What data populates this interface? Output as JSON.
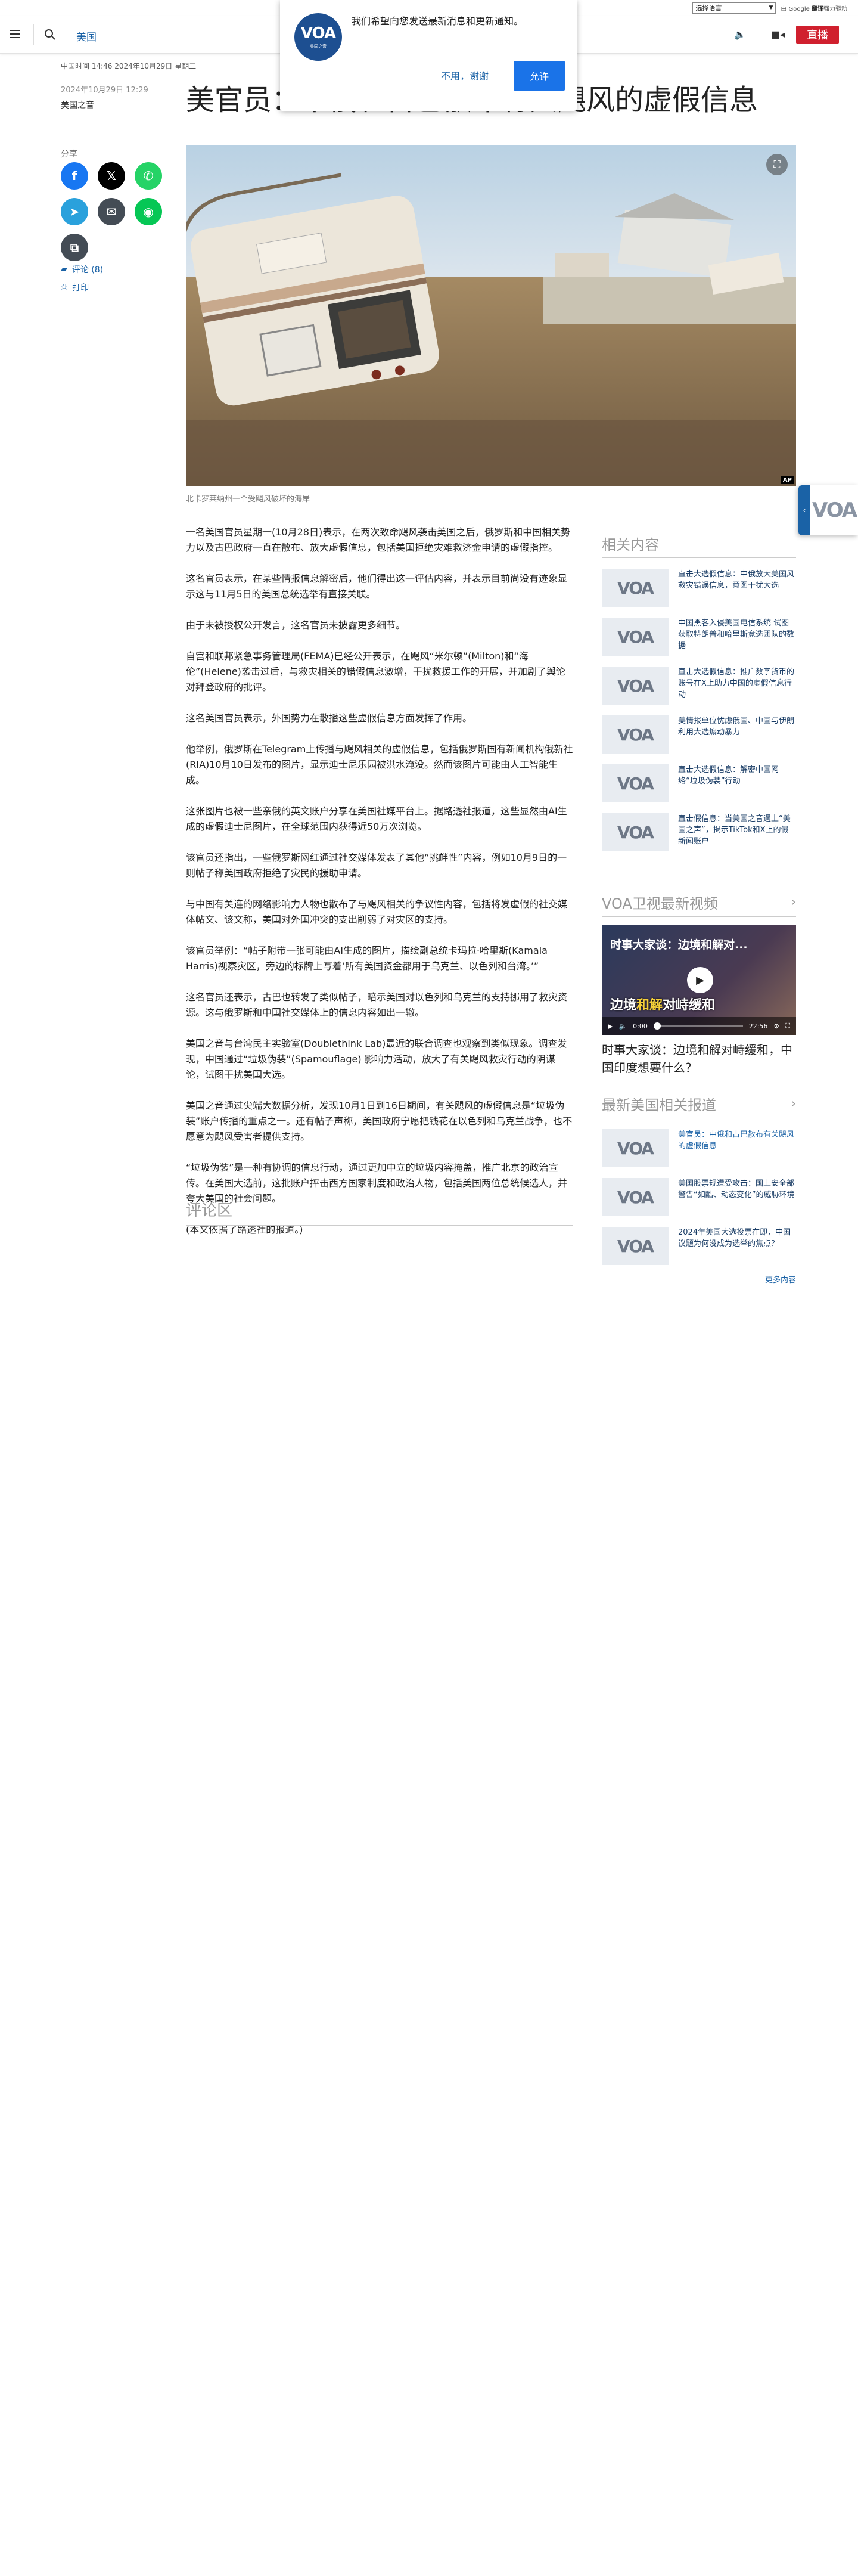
{
  "translate": {
    "select_label": "选择语言",
    "gt_prefix": "由 Google",
    "gt_brand": "翻译",
    "gt_suffix": "强力驱动"
  },
  "header": {
    "section": "美国",
    "live_label": "直播"
  },
  "notification": {
    "logo_text": "VOA",
    "logo_sub": "美国之音",
    "message": "我们希望向您发送最新消息和更新通知。",
    "decline_label": "不用，谢谢",
    "allow_label": "允许"
  },
  "meta": {
    "time": "中国时间 14:46 2024年10月29日 星期二",
    "date": "2024年10月29日 12:29",
    "category": "美国之音"
  },
  "article": {
    "headline": "美官员：中俄和古巴散布有关飓风的虚假信息",
    "caption": "北卡罗莱纳州一个受飓风破坏的海岸",
    "ap_badge": "AP",
    "paragraphs": [
      "一名美国官员星期一(10月28日)表示，在两次致命飓风袭击美国之后，俄罗斯和中国相关势力以及古巴政府一直在散布、放大虚假信息，包括美国拒绝灾难救济金申请的虚假指控。",
      "这名官员表示，在某些情报信息解密后，他们得出这一评估内容，并表示目前尚没有迹象显示这与11月5日的美国总统选举有直接关联。",
      "由于未被授权公开发言，这名官员未披露更多细节。",
      "自宫和联邦紧急事务管理局(FEMA)已经公开表示，在飓风“米尔顿”(Milton)和“海伦”(Helene)袭击过后，与救灾相关的错假信息激增，干扰救援工作的开展，并加剧了舆论对拜登政府的批评。",
      "这名美国官员表示，外国势力在散播这些虚假信息方面发挥了作用。",
      "他举例，俄罗斯在Telegram上传播与飓风相关的虚假信息，包括俄罗斯国有新闻机构俄新社(RIA)10月10日发布的图片，显示迪士尼乐园被洪水淹没。然而该图片可能由人工智能生成。",
      "这张图片也被一些亲俄的英文账户分享在美国社媒平台上。据路透社报道，这些显然由AI生成的虚假迪士尼图片，在全球范围内获得近50万次浏览。",
      "该官员还指出，一些俄罗斯网红通过社交媒体发表了其他“挑衅性”内容，例如10月9日的一则帖子称美国政府拒绝了灾民的援助申请。",
      "与中国有关连的网络影响力人物也散布了与飓风相关的争议性内容，包括将发虚假的社交媒体帖文、该文称，美国对外国冲突的支出削弱了对灾区的支持。",
      "该官员举例：“帖子附带一张可能由AI生成的图片，描绘副总统卡玛拉·哈里斯(Kamala Harris)视察灾区，旁边的标牌上写着‘所有美国资金都用于乌克兰、以色列和台湾。’”",
      "这名官员还表示，古巴也转发了类似帖子，暗示美国对以色列和乌克兰的支持挪用了救灾资源。这与俄罗斯和中国社交媒体上的信息内容如出一辙。",
      "美国之音与台湾民主实验室(Doublethink Lab)最近的联合调查也观察到类似现象。调查发现，中国通过“垃圾伪装”(Spamouflage) 影响力活动，放大了有关飓风救灾行动的阴谋论，试图干扰美国大选。",
      "美国之音通过尖端大数据分析，发现10月1日到16日期间，有关飓风的虚假信息是“垃圾伪装”账户传播的重点之一。还有帖子声称，美国政府宁愿把钱花在以色列和乌克兰战争，也不愿意为飓风受害者提供支持。",
      "“垃圾伪装”是一种有协调的信息行动，通过更加中立的垃圾内容掩盖，推广北京的政治宣传。在美国大选前，这批账户抨击西方国家制度和政治人物，包括美国两位总统候选人，并夸大美国的社会问题。",
      "(本文依据了路透社的报道。)"
    ],
    "comments_title": "评论区"
  },
  "share": {
    "label": "分享",
    "comments_link": "评论 (8)",
    "print_link": "打印"
  },
  "sidebar": {
    "related": {
      "title": "相关内容",
      "thumb_logo": "VOA",
      "items": [
        "直击大选假信息：中俄放大美国风救灾错误信息，意图干扰大选",
        "中国黑客入侵美国电信系统 试图获取特朗普和哈里斯竞选团队的数据",
        "直击大选假信息：推广数字货币的账号在X上助力中国的虚假信息行动",
        "美情报单位忧虑俄国、中国与伊朗利用大选煽动暴力",
        "直击大选假信息：解密中国网络“垃圾伪装”行动",
        "直击假信息：当美国之音遇上“美国之声”，揭示TikTok和X上的假新闻账户"
      ]
    },
    "video": {
      "title": "VOA卫视最新视频",
      "overlay_title": "时事大家谈：边境和解对...",
      "overlay_line_1": "边境",
      "overlay_hl": "和解",
      "overlay_line_2": "对峙缓和",
      "time_current": "0:00",
      "time_total": "22:56",
      "caption": "时事大家谈：边境和解对峙缓和，中国印度想要什么？"
    },
    "latest": {
      "title": "最新美国相关报道",
      "items": [
        "美官员：中俄和古巴散布有关飓风的虚假信息",
        "美国股票规遭受攻击：国土安全部警告“如酷、动态变化”的威胁环境",
        "2024年美国大选投票在即，中国议题为何没成为选举的焦点？"
      ],
      "more_label": "更多内容"
    }
  },
  "float_tab": {
    "logo": "VOA"
  },
  "colors": {
    "accent": "#1a62a6",
    "live": "#d0202e",
    "allow": "#1a73e8"
  }
}
